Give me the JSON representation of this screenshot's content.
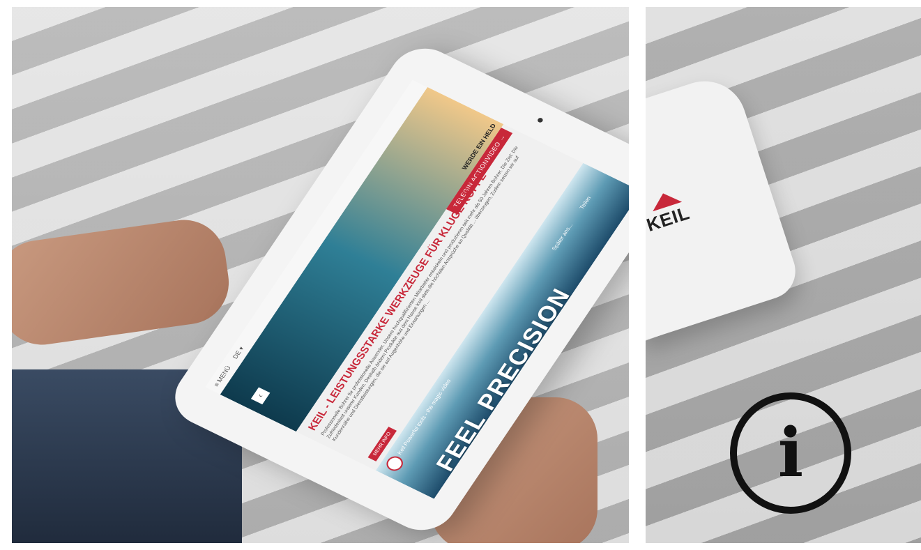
{
  "screen": {
    "menu_label": "≡ MENÜ",
    "language_label": "DE ▾",
    "back_icon": "chevron-left-icon",
    "headline": "KEIL - LEISTUNGSSTARKE WERKZEUGE FÜR KLUGE KÖPFE",
    "body_text": "Professionelle Bohrer für professionelle Anwender. Unsere hochqualifizierten Mitarbeiter entwickeln und produzieren seit mehr als 50 Jahren Bohrer. Die Ziel: Die Zufriedenheit unserer Kunden. Deshalb ändern Produkte aus dem Hause Keil stets die höchsten Ansprüche an Qualität ... überzeugen, Zudem setzen wir auf Kundennähe und Dienstleistungen, die sie auf Augenhöhe und Erwartungen ...",
    "read_more_label": "MEHR INFO",
    "tagline": "WERDE EIN HELD",
    "cta_label": "TELEGIN ACTIONVIDEO →",
    "video_title": "Keil Powerful tools - the magic video",
    "hero_text": "FEEL PRECISION",
    "share_labels": [
      "Später ans...",
      "Teilen"
    ]
  },
  "logo": {
    "text": "KEIL",
    "roof_color": "#c8283a"
  },
  "info_button": {
    "glyph": "i",
    "icon": "info-icon"
  },
  "colors": {
    "accent": "#c8283a"
  }
}
